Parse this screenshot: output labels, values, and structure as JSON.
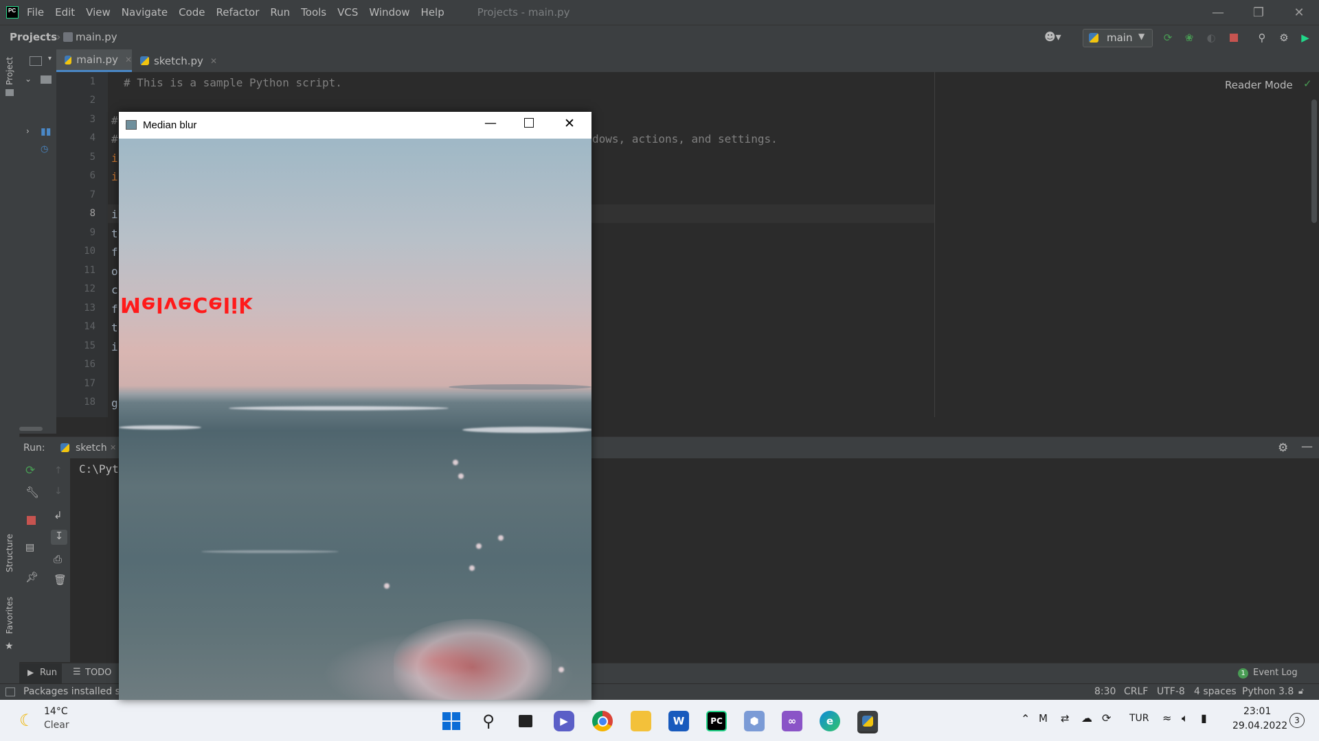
{
  "ide": {
    "menu": [
      "File",
      "Edit",
      "View",
      "Navigate",
      "Code",
      "Refactor",
      "Run",
      "Tools",
      "VCS",
      "Window",
      "Help"
    ],
    "window_title": "Projects - main.py",
    "breadcrumb": {
      "root": "Projects",
      "file": "main.py"
    },
    "run_config": "main",
    "tabs": [
      {
        "label": "main.py",
        "active": true
      },
      {
        "label": "sketch.py",
        "active": false
      }
    ],
    "reader_mode": "Reader Mode",
    "left_tools": [
      "Project",
      "Structure",
      "Favorites"
    ],
    "code_visible": {
      "line1": "# This is a sample Python script.",
      "line4_tail": "dows, actions, and settings.",
      "line_prefixes": [
        "#",
        "#",
        "i",
        "i",
        "i",
        "t",
        "f",
        "o",
        "c",
        "f",
        "t",
        "i",
        "g"
      ]
    },
    "line_numbers": [
      "1",
      "2",
      "3",
      "4",
      "5",
      "6",
      "7",
      "8",
      "9",
      "10",
      "11",
      "12",
      "13",
      "14",
      "15",
      "16",
      "17",
      "18"
    ],
    "current_line": "8",
    "run_panel": {
      "label": "Run:",
      "tab": "sketch",
      "console_text": "C:\\Pyt"
    },
    "bottom_tabs": {
      "run": "Run",
      "todo": "TODO",
      "event_log": "Event Log",
      "event_count": "1"
    },
    "status": {
      "message": "Packages installed su",
      "position": "8:30",
      "line_sep": "CRLF",
      "encoding": "UTF-8",
      "indent": "4 spaces",
      "interpreter": "Python 3.8"
    }
  },
  "popup": {
    "title": "Median blur",
    "watermark_text": "MelveCelik"
  },
  "taskbar": {
    "weather_temp": "14°C",
    "weather_desc": "Clear",
    "language": "TUR",
    "time": "23:01",
    "date": "29.04.2022",
    "notifications": "3"
  },
  "colors": {
    "ide_bg": "#2b2b2b",
    "panel_bg": "#3c3f41",
    "accent_blue": "#4a88c7",
    "run_green": "#499c54",
    "stop_red": "#c75450",
    "watermark_red": "#ff1a1a"
  }
}
